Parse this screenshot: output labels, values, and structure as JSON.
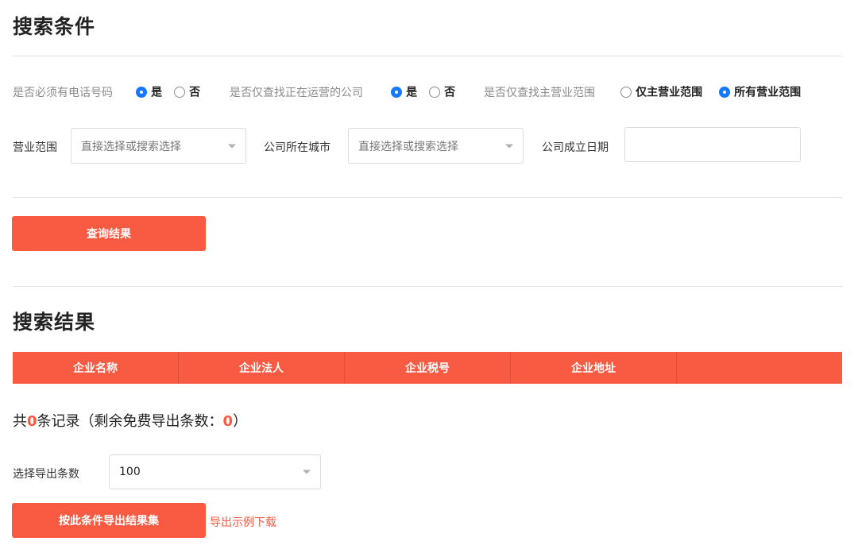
{
  "search_conditions": {
    "title": "搜索条件",
    "phone_required": {
      "label": "是否必须有电话号码",
      "options": [
        "是",
        "否"
      ],
      "selected": "是"
    },
    "operating_only": {
      "label": "是否仅查找正在运营的公司",
      "options": [
        "是",
        "否"
      ],
      "selected": "是"
    },
    "main_scope_only": {
      "label": "是否仅查找主营业范围",
      "options": [
        "仅主营业范围",
        "所有营业范围"
      ],
      "selected": "所有营业范围"
    },
    "business_scope": {
      "label": "营业范围",
      "placeholder": "直接选择或搜索选择"
    },
    "company_city": {
      "label": "公司所在城市",
      "placeholder": "直接选择或搜索选择"
    },
    "founded_date": {
      "label": "公司成立日期",
      "value": ""
    },
    "query_button": "查询结果"
  },
  "search_results": {
    "title": "搜索结果",
    "columns": [
      "企业名称",
      "企业法人",
      "企业税号",
      "企业地址",
      ""
    ],
    "summary": {
      "prefix": "共",
      "total": "0",
      "middle": "条记录（剩余免费导出条数：",
      "remaining": "0",
      "suffix": "）"
    },
    "export": {
      "count_label": "选择导出条数",
      "count_value": "100",
      "export_button": "按此条件导出结果集",
      "example_link": "导出示例下载"
    }
  },
  "colors": {
    "accent": "#f85a42",
    "radio": "#1677ff"
  }
}
